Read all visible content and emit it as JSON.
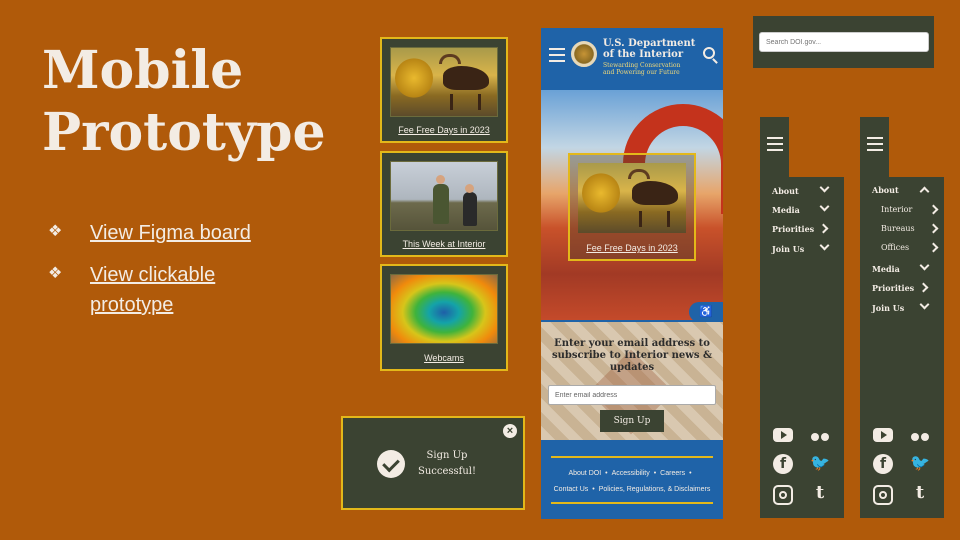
{
  "slide": {
    "title_line1": "Mobile",
    "title_line2": "Prototype",
    "links": [
      {
        "label": "View Figma board"
      },
      {
        "label": "View clickable prototype"
      }
    ],
    "bullet_glyph": "❖"
  },
  "cards": [
    {
      "caption": "Fee Free Days in 2023",
      "image": "moose-photo"
    },
    {
      "caption": "This Week at Interior",
      "image": "people-photo"
    },
    {
      "caption": "Webcams",
      "image": "hot-spring-photo"
    }
  ],
  "phone": {
    "title_line1": "U.S. Department",
    "title_line2": "of the Interior",
    "tagline_line1": "Stewarding Conservation",
    "tagline_line2": "and Powering our Future",
    "hero_caption": "Fee Free Days in 2023",
    "signup_text": "Enter your email address to subscribe to Interior news & updates",
    "email_placeholder": "Enter email address",
    "signup_button": "Sign Up",
    "accessibility_icon": "♿",
    "footer_links_row1": [
      "About DOI",
      "Accessibility",
      "Careers"
    ],
    "footer_links_row2": [
      "Contact Us",
      "Policies, Regulations, & Disclaimers"
    ],
    "footer_separator": "•"
  },
  "search": {
    "placeholder": "Search DOI.gov..."
  },
  "menu_collapsed": {
    "items": [
      {
        "label": "About",
        "chevron": "down"
      },
      {
        "label": "Media",
        "chevron": "down"
      },
      {
        "label": "Priorities",
        "chevron": "right"
      },
      {
        "label": "Join Us",
        "chevron": "down"
      }
    ]
  },
  "menu_expanded": {
    "items": [
      {
        "label": "About",
        "chevron": "up"
      },
      {
        "label": "Interior",
        "chevron": "right",
        "sub": true
      },
      {
        "label": "Bureaus",
        "chevron": "right",
        "sub": true
      },
      {
        "label": "Offices",
        "chevron": "right",
        "sub": true
      },
      {
        "label": "Media",
        "chevron": "down"
      },
      {
        "label": "Priorities",
        "chevron": "right"
      },
      {
        "label": "Join Us",
        "chevron": "down"
      }
    ]
  },
  "social": {
    "facebook_glyph": "f",
    "twitter_glyph": "🐦",
    "tumblr_glyph": "t"
  },
  "toast": {
    "message_line1": "Sign Up",
    "message_line2": "Successful!",
    "close_glyph": "×"
  },
  "colors": {
    "background": "#b05a0a",
    "panel": "#3b4332",
    "accent": "#e3b81a",
    "phone_blue": "#1f63a8"
  }
}
